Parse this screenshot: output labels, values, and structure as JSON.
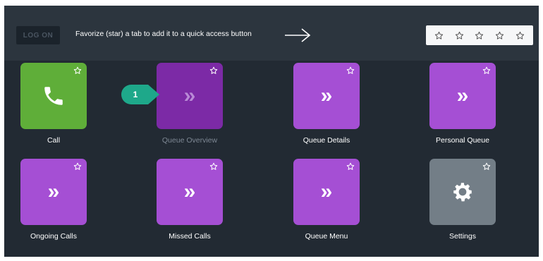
{
  "topbar": {
    "logon_label": "LOG ON",
    "hint": "Favorize (star) a tab to add it to a quick access button",
    "quick_slots": 5
  },
  "colors": {
    "background": "#222a33",
    "topbar": "#2c353e",
    "green": "#5fae39",
    "purple": "#a54fd4",
    "purple_selected": "#7c2aa6",
    "gray": "#737e87",
    "badge": "#1ea88a"
  },
  "tiles": [
    {
      "label": "Call",
      "icon": "phone-icon",
      "color": "green"
    },
    {
      "label": "Queue Overview",
      "icon": "double-chevron-icon",
      "color": "purple_selected",
      "selected": true
    },
    {
      "label": "Queue Details",
      "icon": "double-chevron-icon",
      "color": "purple"
    },
    {
      "label": "Personal Queue",
      "icon": "double-chevron-icon",
      "color": "purple"
    },
    {
      "label": "Ongoing Calls",
      "icon": "double-chevron-icon",
      "color": "purple"
    },
    {
      "label": "Missed Calls",
      "icon": "double-chevron-icon",
      "color": "purple"
    },
    {
      "label": "Queue Menu",
      "icon": "double-chevron-icon",
      "color": "purple"
    },
    {
      "label": "Settings",
      "icon": "gear-icon",
      "color": "gray"
    }
  ],
  "callout": {
    "number": "1"
  }
}
